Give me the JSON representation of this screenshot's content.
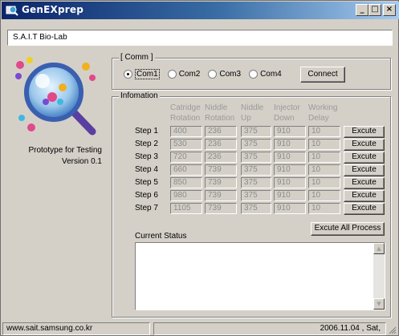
{
  "window": {
    "title": "GenEXprep"
  },
  "title_buttons": {
    "minimize": "_",
    "maximize": "□",
    "close": "×"
  },
  "header": {
    "org": "S.A.I.T Bio-Lab"
  },
  "left_panel": {
    "line1": "Prototype for Testing",
    "line2": "Version 0.1"
  },
  "comm": {
    "group_title": "[ Comm ]",
    "ports": [
      {
        "label": "Com1",
        "selected": true
      },
      {
        "label": "Com2",
        "selected": false
      },
      {
        "label": "Com3",
        "selected": false
      },
      {
        "label": "Com4",
        "selected": false
      }
    ],
    "connect_label": "Connect"
  },
  "info": {
    "group_title": "Infomation",
    "headers": [
      [
        "Catridge",
        "Rotation"
      ],
      [
        "Niddle",
        "Rotation"
      ],
      [
        "Niddle",
        "Up"
      ],
      [
        "Injector",
        "Down"
      ],
      [
        "Working",
        "Delay"
      ]
    ],
    "execute_label": "Excute",
    "steps": [
      {
        "label": "Step 1",
        "values": [
          "400",
          "236",
          "375",
          "910",
          "10"
        ]
      },
      {
        "label": "Step 2",
        "values": [
          "530",
          "236",
          "375",
          "910",
          "10"
        ]
      },
      {
        "label": "Step 3",
        "values": [
          "720",
          "236",
          "375",
          "910",
          "10"
        ]
      },
      {
        "label": "Step 4",
        "values": [
          "660",
          "739",
          "375",
          "910",
          "10"
        ]
      },
      {
        "label": "Step 5",
        "values": [
          "850",
          "739",
          "375",
          "910",
          "10"
        ]
      },
      {
        "label": "Step 6",
        "values": [
          "980",
          "739",
          "375",
          "910",
          "10"
        ]
      },
      {
        "label": "Step 7",
        "values": [
          "1105",
          "739",
          "375",
          "910",
          "10"
        ]
      }
    ],
    "execute_all_label": "Excute All Process",
    "current_status_label": "Current Status",
    "current_status_text": ""
  },
  "statusbar": {
    "url": "www.sait.samsung.co.kr",
    "date": "2006.11.04 ,  Sat,"
  },
  "colors": {
    "title_start": "#0a246a",
    "title_end": "#a6caf0",
    "face": "#d4d0c8"
  }
}
